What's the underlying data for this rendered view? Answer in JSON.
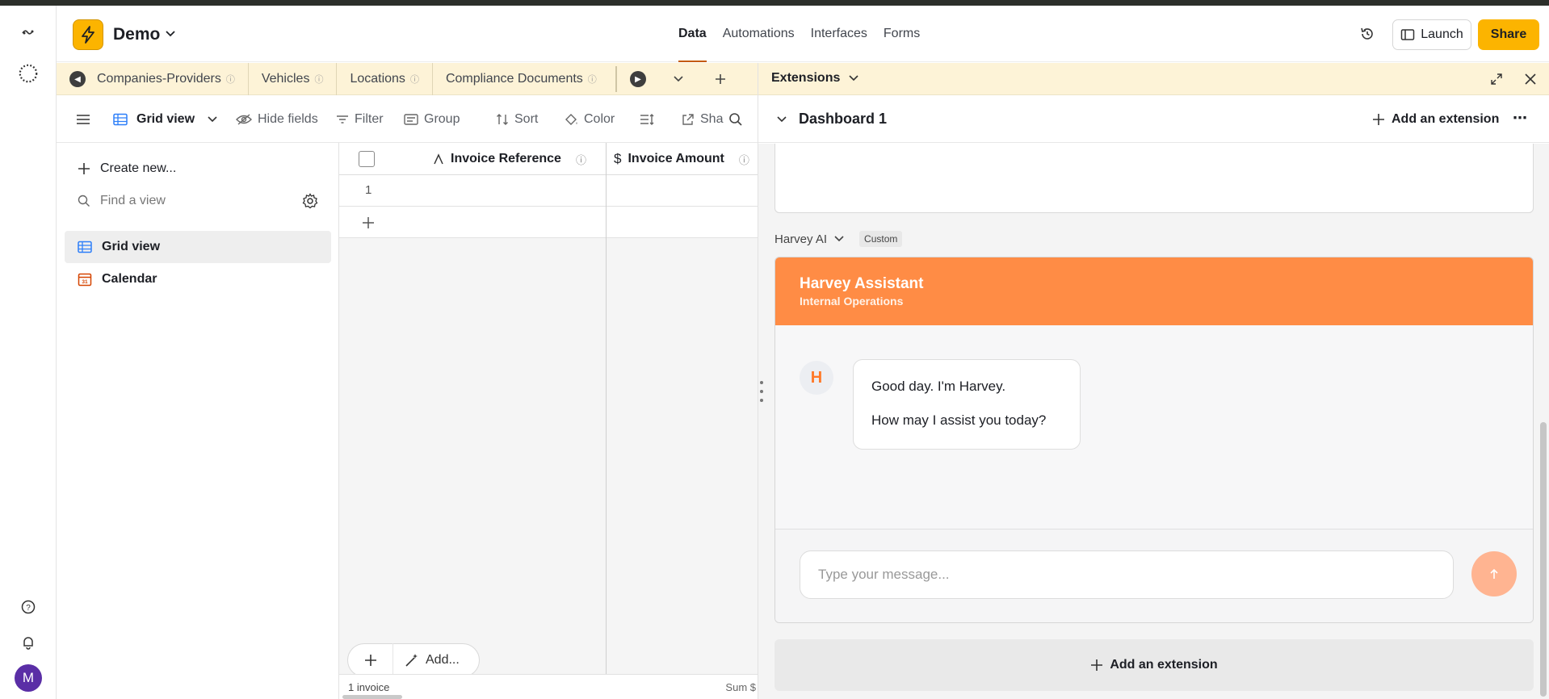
{
  "header": {
    "base_name": "Demo",
    "nav_tabs": [
      "Data",
      "Automations",
      "Interfaces",
      "Forms"
    ],
    "active_tab": "Data",
    "launch_label": "Launch",
    "share_label": "Share"
  },
  "table_tabs": [
    "Companies-Providers",
    "Vehicles",
    "Locations",
    "Compliance Documents"
  ],
  "viewbar": {
    "view_label": "Grid view",
    "hide_fields": "Hide fields",
    "filter": "Filter",
    "group": "Group",
    "sort": "Sort",
    "color": "Color",
    "share": "Sha"
  },
  "sidebar": {
    "create_new": "Create new...",
    "find_placeholder": "Find a view",
    "views": [
      "Grid view",
      "Calendar"
    ]
  },
  "grid": {
    "columns": [
      "Invoice Reference",
      "Invoice Amount"
    ],
    "rows": [
      {
        "num": "1"
      }
    ],
    "add_label": "Add...",
    "footer_count": "1 invoice",
    "footer_sum": "Sum $"
  },
  "extensions": {
    "title": "Extensions",
    "dashboard_title": "Dashboard 1",
    "add_extension": "Add an extension",
    "section_label": "Harvey AI",
    "section_badge": "Custom",
    "assistant_title": "Harvey Assistant",
    "assistant_subtitle": "Internal Operations",
    "avatar_letter": "H",
    "message_line1": "Good day. I'm Harvey.",
    "message_line2": "How may I assist you today?",
    "input_placeholder": "Type your message...",
    "add_extension_bottom": "Add an extension"
  },
  "user": {
    "avatar_letter": "M"
  },
  "colors": {
    "brand": "#fcb400",
    "assistant_header": "#ff8c45",
    "send_button": "#ffb491"
  }
}
